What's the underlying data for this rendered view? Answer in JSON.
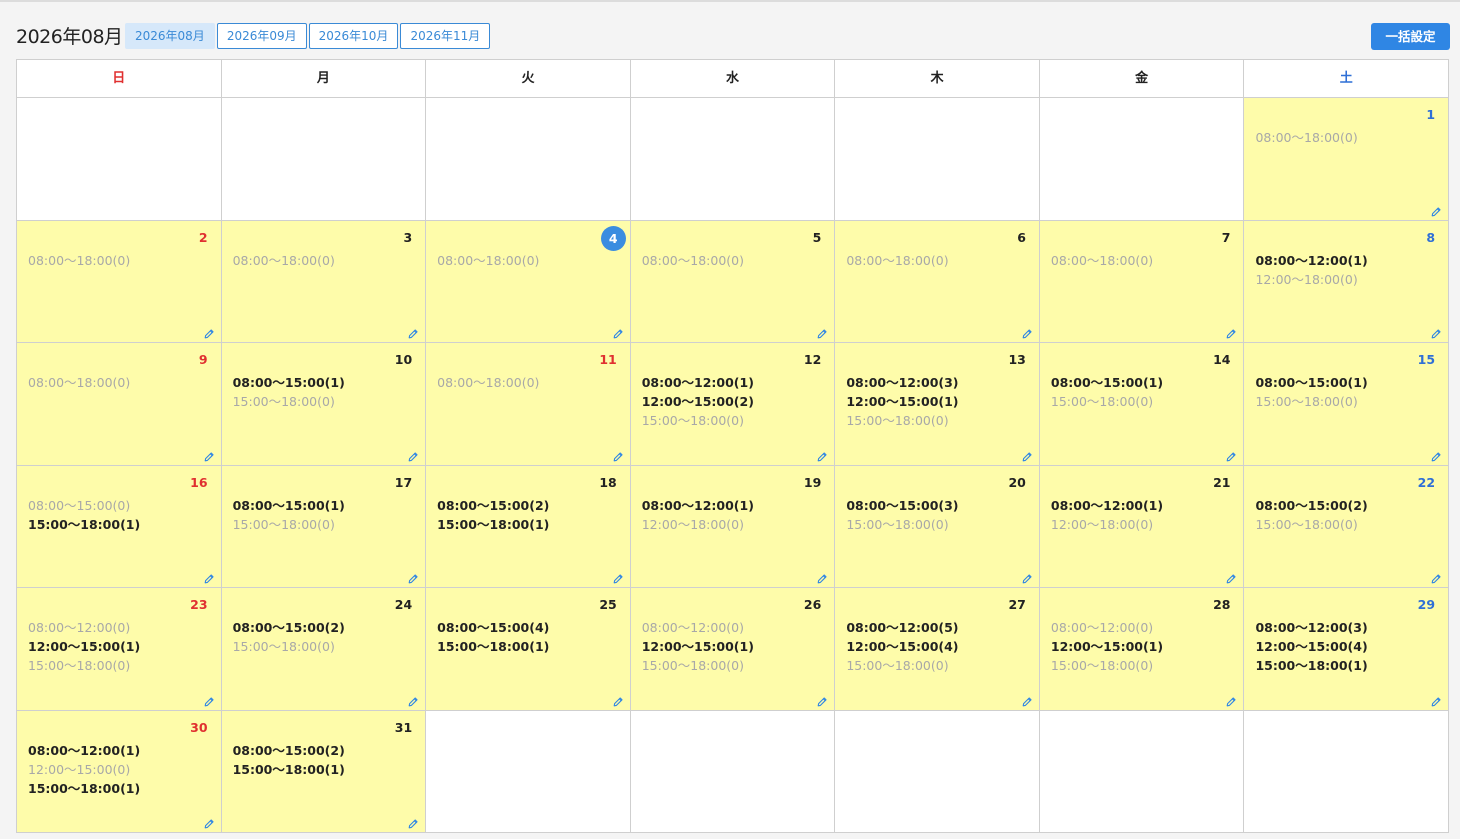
{
  "header": {
    "title": "2026年08月",
    "month_tabs": [
      "2026年08月",
      "2026年09月",
      "2026年10月",
      "2026年11月"
    ],
    "active_tab": "2026年08月",
    "bulk_button": "一括設定"
  },
  "weekdays": [
    "日",
    "月",
    "火",
    "水",
    "木",
    "金",
    "土"
  ],
  "colors": {
    "sunday": "#e03030",
    "saturday": "#2f6fd6",
    "active_day_bg": "#fefcaa",
    "today_badge": "#3a8de0",
    "accent": "#2f86e4"
  },
  "today": 4,
  "weeks": [
    [
      null,
      null,
      null,
      null,
      null,
      null,
      {
        "day": 1,
        "slots": [
          {
            "t": "08:00〜18:00(0)",
            "open": false
          }
        ]
      }
    ],
    [
      {
        "day": 2,
        "slots": [
          {
            "t": "08:00〜18:00(0)",
            "open": false
          }
        ]
      },
      {
        "day": 3,
        "slots": [
          {
            "t": "08:00〜18:00(0)",
            "open": false
          }
        ]
      },
      {
        "day": 4,
        "slots": [
          {
            "t": "08:00〜18:00(0)",
            "open": false
          }
        ]
      },
      {
        "day": 5,
        "slots": [
          {
            "t": "08:00〜18:00(0)",
            "open": false
          }
        ]
      },
      {
        "day": 6,
        "slots": [
          {
            "t": "08:00〜18:00(0)",
            "open": false
          }
        ]
      },
      {
        "day": 7,
        "slots": [
          {
            "t": "08:00〜18:00(0)",
            "open": false
          }
        ]
      },
      {
        "day": 8,
        "slots": [
          {
            "t": "08:00〜12:00(1)",
            "open": true
          },
          {
            "t": "12:00〜18:00(0)",
            "open": false
          }
        ]
      }
    ],
    [
      {
        "day": 9,
        "slots": [
          {
            "t": "08:00〜18:00(0)",
            "open": false
          }
        ]
      },
      {
        "day": 10,
        "slots": [
          {
            "t": "08:00〜15:00(1)",
            "open": true
          },
          {
            "t": "15:00〜18:00(0)",
            "open": false
          }
        ]
      },
      {
        "day": 11,
        "holiday": true,
        "slots": [
          {
            "t": "08:00〜18:00(0)",
            "open": false
          }
        ]
      },
      {
        "day": 12,
        "slots": [
          {
            "t": "08:00〜12:00(1)",
            "open": true
          },
          {
            "t": "12:00〜15:00(2)",
            "open": true
          },
          {
            "t": "15:00〜18:00(0)",
            "open": false
          }
        ]
      },
      {
        "day": 13,
        "slots": [
          {
            "t": "08:00〜12:00(3)",
            "open": true
          },
          {
            "t": "12:00〜15:00(1)",
            "open": true
          },
          {
            "t": "15:00〜18:00(0)",
            "open": false
          }
        ]
      },
      {
        "day": 14,
        "slots": [
          {
            "t": "08:00〜15:00(1)",
            "open": true
          },
          {
            "t": "15:00〜18:00(0)",
            "open": false
          }
        ]
      },
      {
        "day": 15,
        "slots": [
          {
            "t": "08:00〜15:00(1)",
            "open": true
          },
          {
            "t": "15:00〜18:00(0)",
            "open": false
          }
        ]
      }
    ],
    [
      {
        "day": 16,
        "slots": [
          {
            "t": "08:00〜15:00(0)",
            "open": false
          },
          {
            "t": "15:00〜18:00(1)",
            "open": true
          }
        ]
      },
      {
        "day": 17,
        "slots": [
          {
            "t": "08:00〜15:00(1)",
            "open": true
          },
          {
            "t": "15:00〜18:00(0)",
            "open": false
          }
        ]
      },
      {
        "day": 18,
        "slots": [
          {
            "t": "08:00〜15:00(2)",
            "open": true
          },
          {
            "t": "15:00〜18:00(1)",
            "open": true
          }
        ]
      },
      {
        "day": 19,
        "slots": [
          {
            "t": "08:00〜12:00(1)",
            "open": true
          },
          {
            "t": "12:00〜18:00(0)",
            "open": false
          }
        ]
      },
      {
        "day": 20,
        "slots": [
          {
            "t": "08:00〜15:00(3)",
            "open": true
          },
          {
            "t": "15:00〜18:00(0)",
            "open": false
          }
        ]
      },
      {
        "day": 21,
        "slots": [
          {
            "t": "08:00〜12:00(1)",
            "open": true
          },
          {
            "t": "12:00〜18:00(0)",
            "open": false
          }
        ]
      },
      {
        "day": 22,
        "slots": [
          {
            "t": "08:00〜15:00(2)",
            "open": true
          },
          {
            "t": "15:00〜18:00(0)",
            "open": false
          }
        ]
      }
    ],
    [
      {
        "day": 23,
        "slots": [
          {
            "t": "08:00〜12:00(0)",
            "open": false
          },
          {
            "t": "12:00〜15:00(1)",
            "open": true
          },
          {
            "t": "15:00〜18:00(0)",
            "open": false
          }
        ]
      },
      {
        "day": 24,
        "slots": [
          {
            "t": "08:00〜15:00(2)",
            "open": true
          },
          {
            "t": "15:00〜18:00(0)",
            "open": false
          }
        ]
      },
      {
        "day": 25,
        "slots": [
          {
            "t": "08:00〜15:00(4)",
            "open": true
          },
          {
            "t": "15:00〜18:00(1)",
            "open": true
          }
        ]
      },
      {
        "day": 26,
        "slots": [
          {
            "t": "08:00〜12:00(0)",
            "open": false
          },
          {
            "t": "12:00〜15:00(1)",
            "open": true
          },
          {
            "t": "15:00〜18:00(0)",
            "open": false
          }
        ]
      },
      {
        "day": 27,
        "slots": [
          {
            "t": "08:00〜12:00(5)",
            "open": true
          },
          {
            "t": "12:00〜15:00(4)",
            "open": true
          },
          {
            "t": "15:00〜18:00(0)",
            "open": false
          }
        ]
      },
      {
        "day": 28,
        "slots": [
          {
            "t": "08:00〜12:00(0)",
            "open": false
          },
          {
            "t": "12:00〜15:00(1)",
            "open": true
          },
          {
            "t": "15:00〜18:00(0)",
            "open": false
          }
        ]
      },
      {
        "day": 29,
        "slots": [
          {
            "t": "08:00〜12:00(3)",
            "open": true
          },
          {
            "t": "12:00〜15:00(4)",
            "open": true
          },
          {
            "t": "15:00〜18:00(1)",
            "open": true
          }
        ]
      }
    ],
    [
      {
        "day": 30,
        "slots": [
          {
            "t": "08:00〜12:00(1)",
            "open": true
          },
          {
            "t": "12:00〜15:00(0)",
            "open": false
          },
          {
            "t": "15:00〜18:00(1)",
            "open": true
          }
        ]
      },
      {
        "day": 31,
        "slots": [
          {
            "t": "08:00〜15:00(2)",
            "open": true
          },
          {
            "t": "15:00〜18:00(1)",
            "open": true
          }
        ]
      },
      null,
      null,
      null,
      null,
      null
    ]
  ]
}
